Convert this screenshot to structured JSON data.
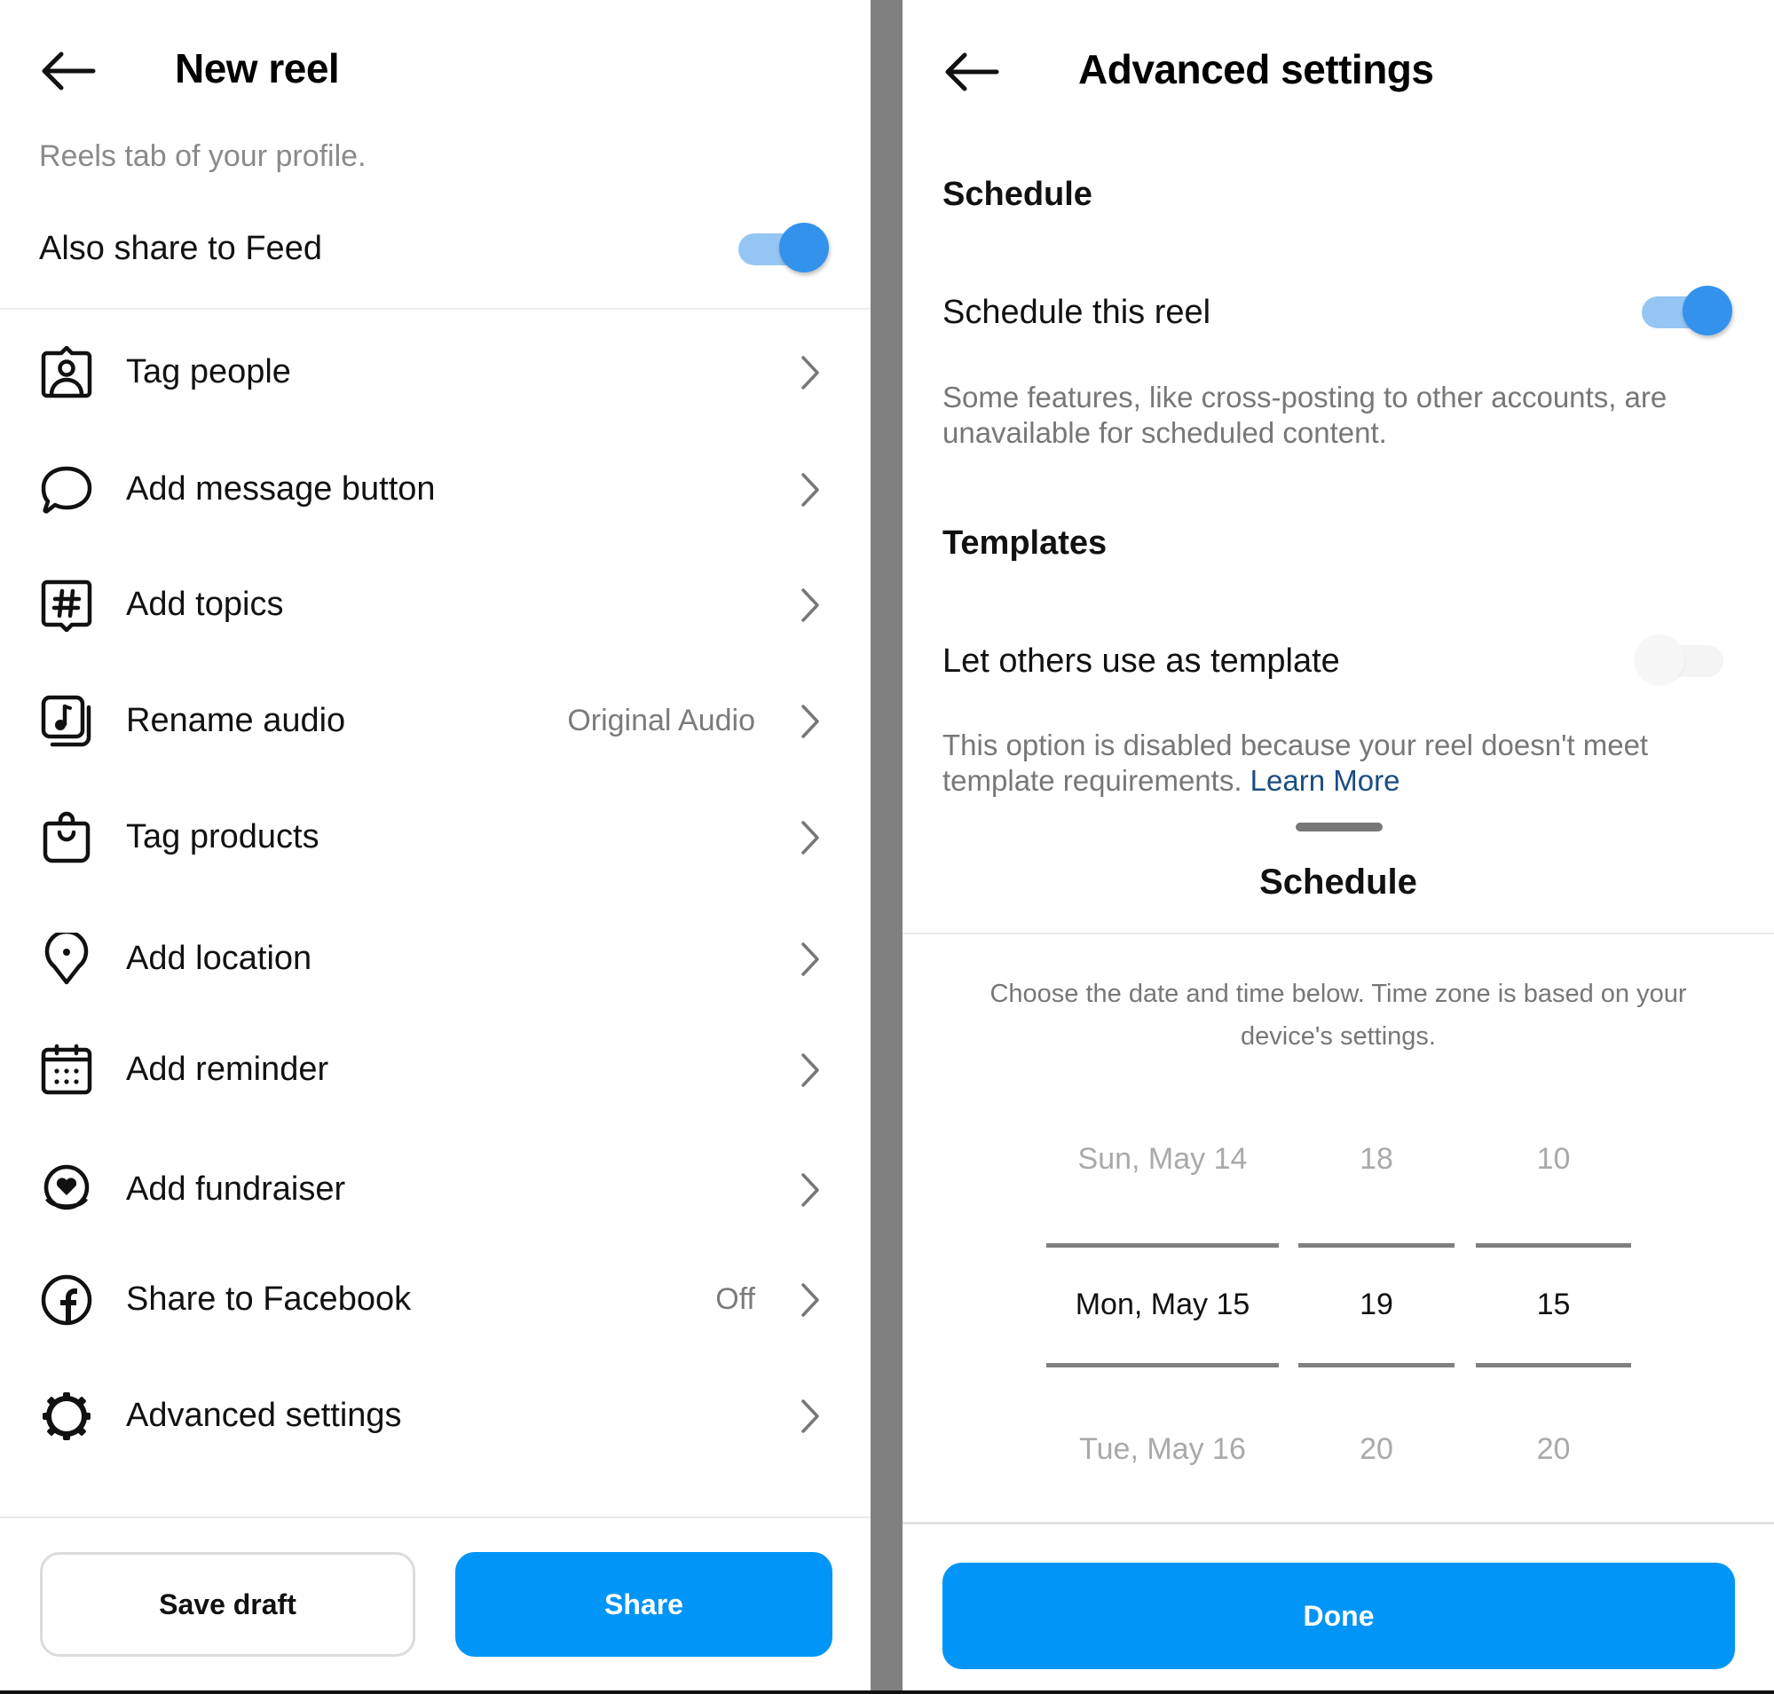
{
  "left_panel": {
    "header": {
      "title": "New reel",
      "back_icon": "arrow-left-icon"
    },
    "caption_fragment": "Reels tab of your profile.",
    "share_to_feed": {
      "label": "Also share to Feed",
      "enabled": true
    },
    "options": [
      {
        "label": "Tag people",
        "icon": "tag-people-icon",
        "value": ""
      },
      {
        "label": "Add message button",
        "icon": "message-bubble-icon",
        "value": ""
      },
      {
        "label": "Add topics",
        "icon": "hashtag-icon",
        "value": ""
      },
      {
        "label": "Rename audio",
        "icon": "music-note-icon",
        "value": "Original Audio"
      },
      {
        "label": "Tag products",
        "icon": "shopping-bag-icon",
        "value": ""
      },
      {
        "label": "Add location",
        "icon": "location-pin-icon",
        "value": ""
      },
      {
        "label": "Add reminder",
        "icon": "calendar-icon",
        "value": ""
      },
      {
        "label": "Add fundraiser",
        "icon": "fundraiser-heart-icon",
        "value": ""
      },
      {
        "label": "Share to Facebook",
        "icon": "facebook-icon",
        "value": "Off"
      },
      {
        "label": "Advanced settings",
        "icon": "gear-icon",
        "value": ""
      }
    ],
    "footer": {
      "save_draft_label": "Save draft",
      "share_label": "Share"
    }
  },
  "right_panel": {
    "header": {
      "title": "Advanced settings",
      "back_icon": "arrow-left-icon"
    },
    "schedule_section": {
      "heading": "Schedule",
      "toggle_label": "Schedule this reel",
      "toggle_enabled": true,
      "description": "Some features, like cross-posting to other accounts, are unavailable for scheduled content."
    },
    "templates_section": {
      "heading": "Templates",
      "toggle_label": "Let others use as template",
      "toggle_enabled": false,
      "toggle_disabled": true,
      "description": "This option is disabled because your reel doesn't meet template requirements.",
      "link_label": "Learn More"
    },
    "schedule_sheet": {
      "title": "Schedule",
      "description": "Choose the date and time below. Time zone is based on your device's settings.",
      "picker": {
        "date": {
          "prev": "Sun, May 14",
          "selected": "Mon, May 15",
          "next": "Tue, May 16"
        },
        "hour": {
          "prev": "18",
          "selected": "19",
          "next": "20"
        },
        "minute": {
          "prev": "10",
          "selected": "15",
          "next": "20"
        }
      },
      "done_label": "Done"
    }
  },
  "colors": {
    "primary": "#0095f6",
    "toggle_on_knob": "#3392ec",
    "toggle_on_track": "#95c6f3",
    "link": "#1b4d80",
    "divider": "#808080"
  }
}
